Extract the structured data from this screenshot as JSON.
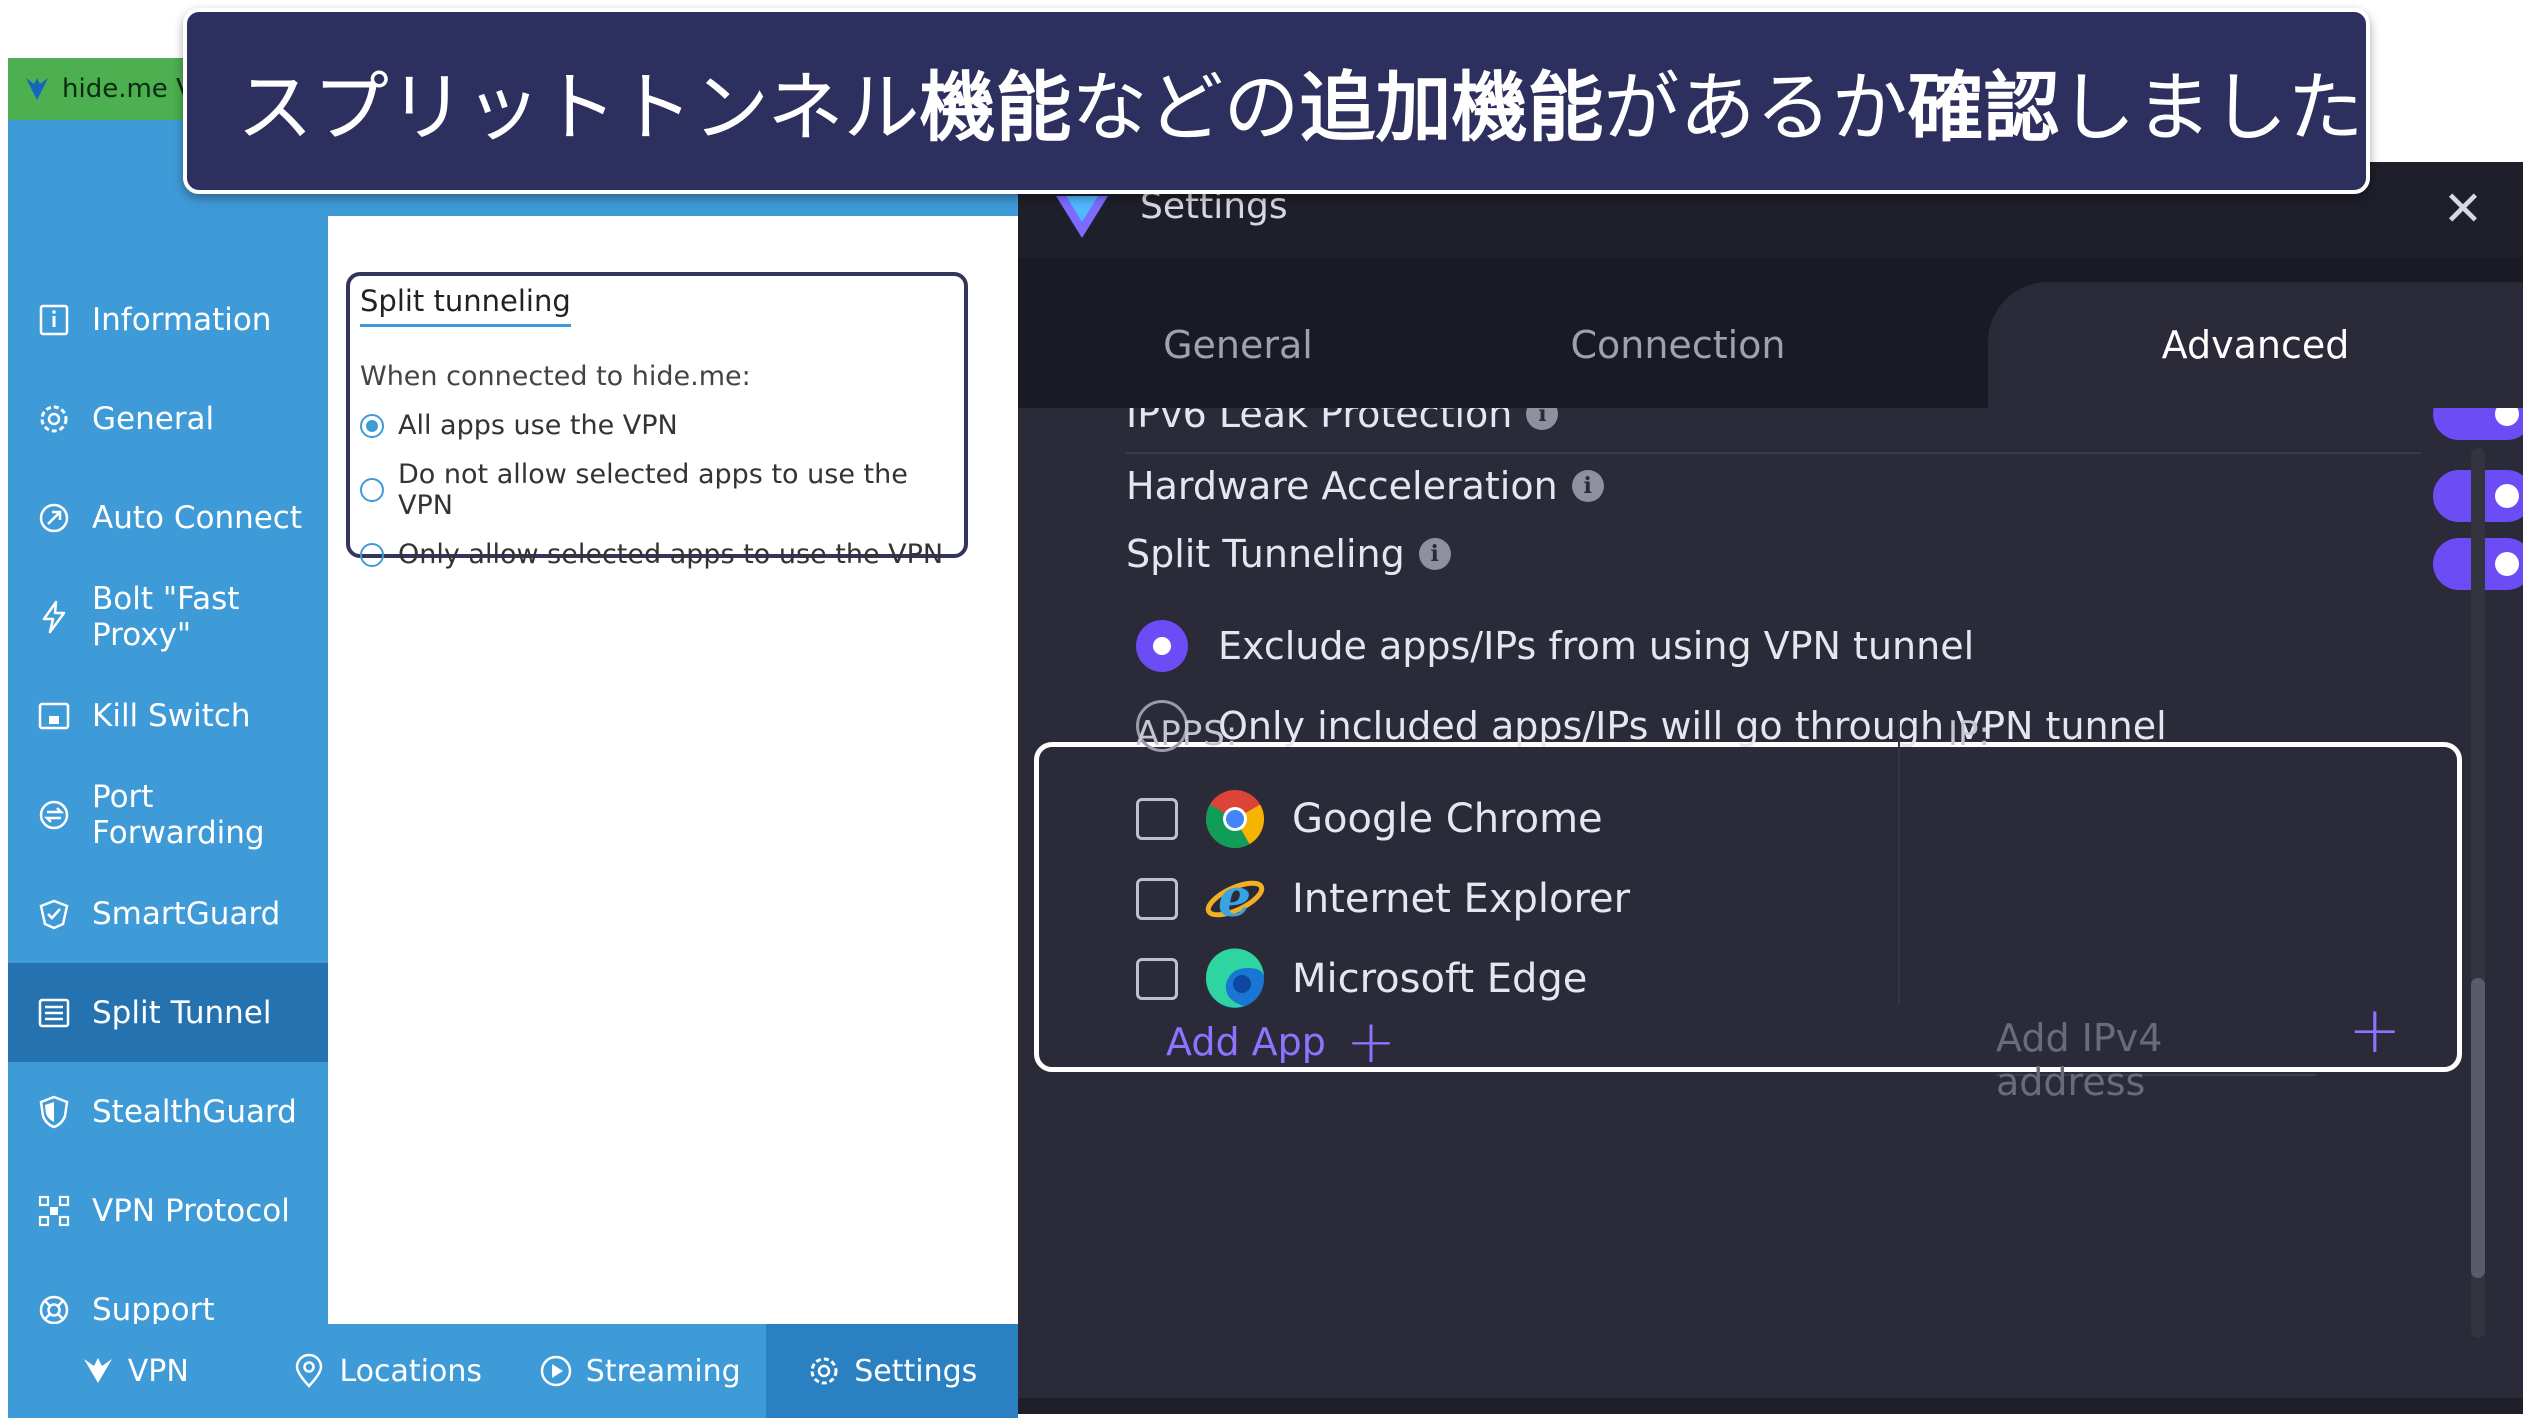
{
  "caption": {
    "part1": "スプリットトンネル",
    "bold1": "機能",
    "part2": "などの",
    "bold2": "追加機能",
    "part3": "があるか",
    "bold3": "確認",
    "part4": "しました"
  },
  "hideme": {
    "window_title": "hide.me V",
    "sidebar": [
      {
        "label": "Information",
        "icon": "info-icon"
      },
      {
        "label": "General",
        "icon": "gear-icon"
      },
      {
        "label": "Auto Connect",
        "icon": "auto-connect-icon"
      },
      {
        "label": "Bolt \"Fast Proxy\"",
        "icon": "bolt-icon"
      },
      {
        "label": "Kill Switch",
        "icon": "kill-switch-icon"
      },
      {
        "label": "Port Forwarding",
        "icon": "port-forwarding-icon"
      },
      {
        "label": "SmartGuard",
        "icon": "smartguard-icon"
      },
      {
        "label": "Split Tunnel",
        "icon": "split-tunnel-icon",
        "active": true
      },
      {
        "label": "StealthGuard",
        "icon": "shield-icon"
      },
      {
        "label": "VPN Protocol",
        "icon": "protocol-icon"
      },
      {
        "label": "Support",
        "icon": "lifebuoy-icon"
      }
    ],
    "split": {
      "title": "Split tunneling",
      "subtitle": "When connected to hide.me:",
      "options": [
        {
          "label": "All apps use the VPN",
          "selected": true
        },
        {
          "label": "Do not allow selected apps to use the VPN",
          "selected": false
        },
        {
          "label": "Only allow selected apps to use the VPN",
          "selected": false
        }
      ]
    },
    "bottom_tabs": [
      {
        "label": "VPN",
        "icon": "vpn-logo-icon"
      },
      {
        "label": "Locations",
        "icon": "location-pin-icon"
      },
      {
        "label": "Streaming",
        "icon": "play-icon"
      },
      {
        "label": "Settings",
        "icon": "gear-icon",
        "active": true
      }
    ],
    "accent_color": "#3f9ad8"
  },
  "settings": {
    "title": "Settings",
    "close": "✕",
    "tabs": [
      "General",
      "Connection",
      "Advanced"
    ],
    "active_tab": "Advanced",
    "rows": {
      "ipv6": "IPv6 Leak Protection",
      "hardware": "Hardware Acceleration",
      "split": "Split Tunneling"
    },
    "toggles": {
      "ipv6": true,
      "hardware": true,
      "split": true
    },
    "split_options": [
      {
        "label": "Exclude apps/IPs from using VPN tunnel",
        "selected": true
      },
      {
        "label": "Only included apps/IPs will go through VPN tunnel",
        "selected": false
      }
    ],
    "apps_label": "APPS:",
    "ip_label": "IP:",
    "apps": [
      {
        "name": "Google Chrome",
        "icon": "chrome-icon",
        "checked": false
      },
      {
        "name": "Internet Explorer",
        "icon": "internet-explorer-icon",
        "checked": false
      },
      {
        "name": "Microsoft Edge",
        "icon": "edge-icon",
        "checked": false
      }
    ],
    "add_app": "Add App",
    "add_ip_placeholder": "Add IPv4 address",
    "accent_color": "#6c4cf5",
    "info_glyph": "i"
  }
}
